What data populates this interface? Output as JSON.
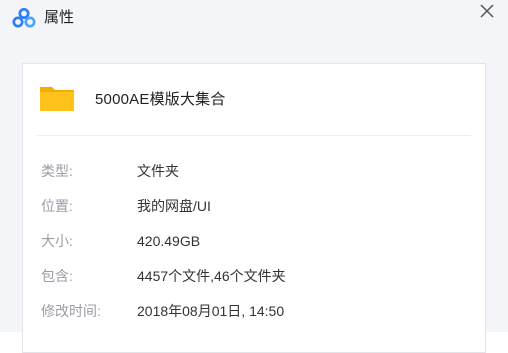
{
  "window": {
    "title": "属性",
    "app_icon": "baidu-netdisk-logo-icon",
    "close_icon": "close-icon",
    "accent_color": "#2b7cf6"
  },
  "file": {
    "icon": "folder-icon",
    "icon_color": "#ffc21a",
    "name": "5000AE模版大集合"
  },
  "properties": [
    {
      "label": "类型:",
      "value": "文件夹"
    },
    {
      "label": "位置:",
      "value": "我的网盘/UI"
    },
    {
      "label": "大小:",
      "value": "420.49GB"
    },
    {
      "label": "包含:",
      "value": "4457个文件,46个文件夹"
    },
    {
      "label": "修改时间:",
      "value": "2018年08月01日, 14:50"
    }
  ]
}
